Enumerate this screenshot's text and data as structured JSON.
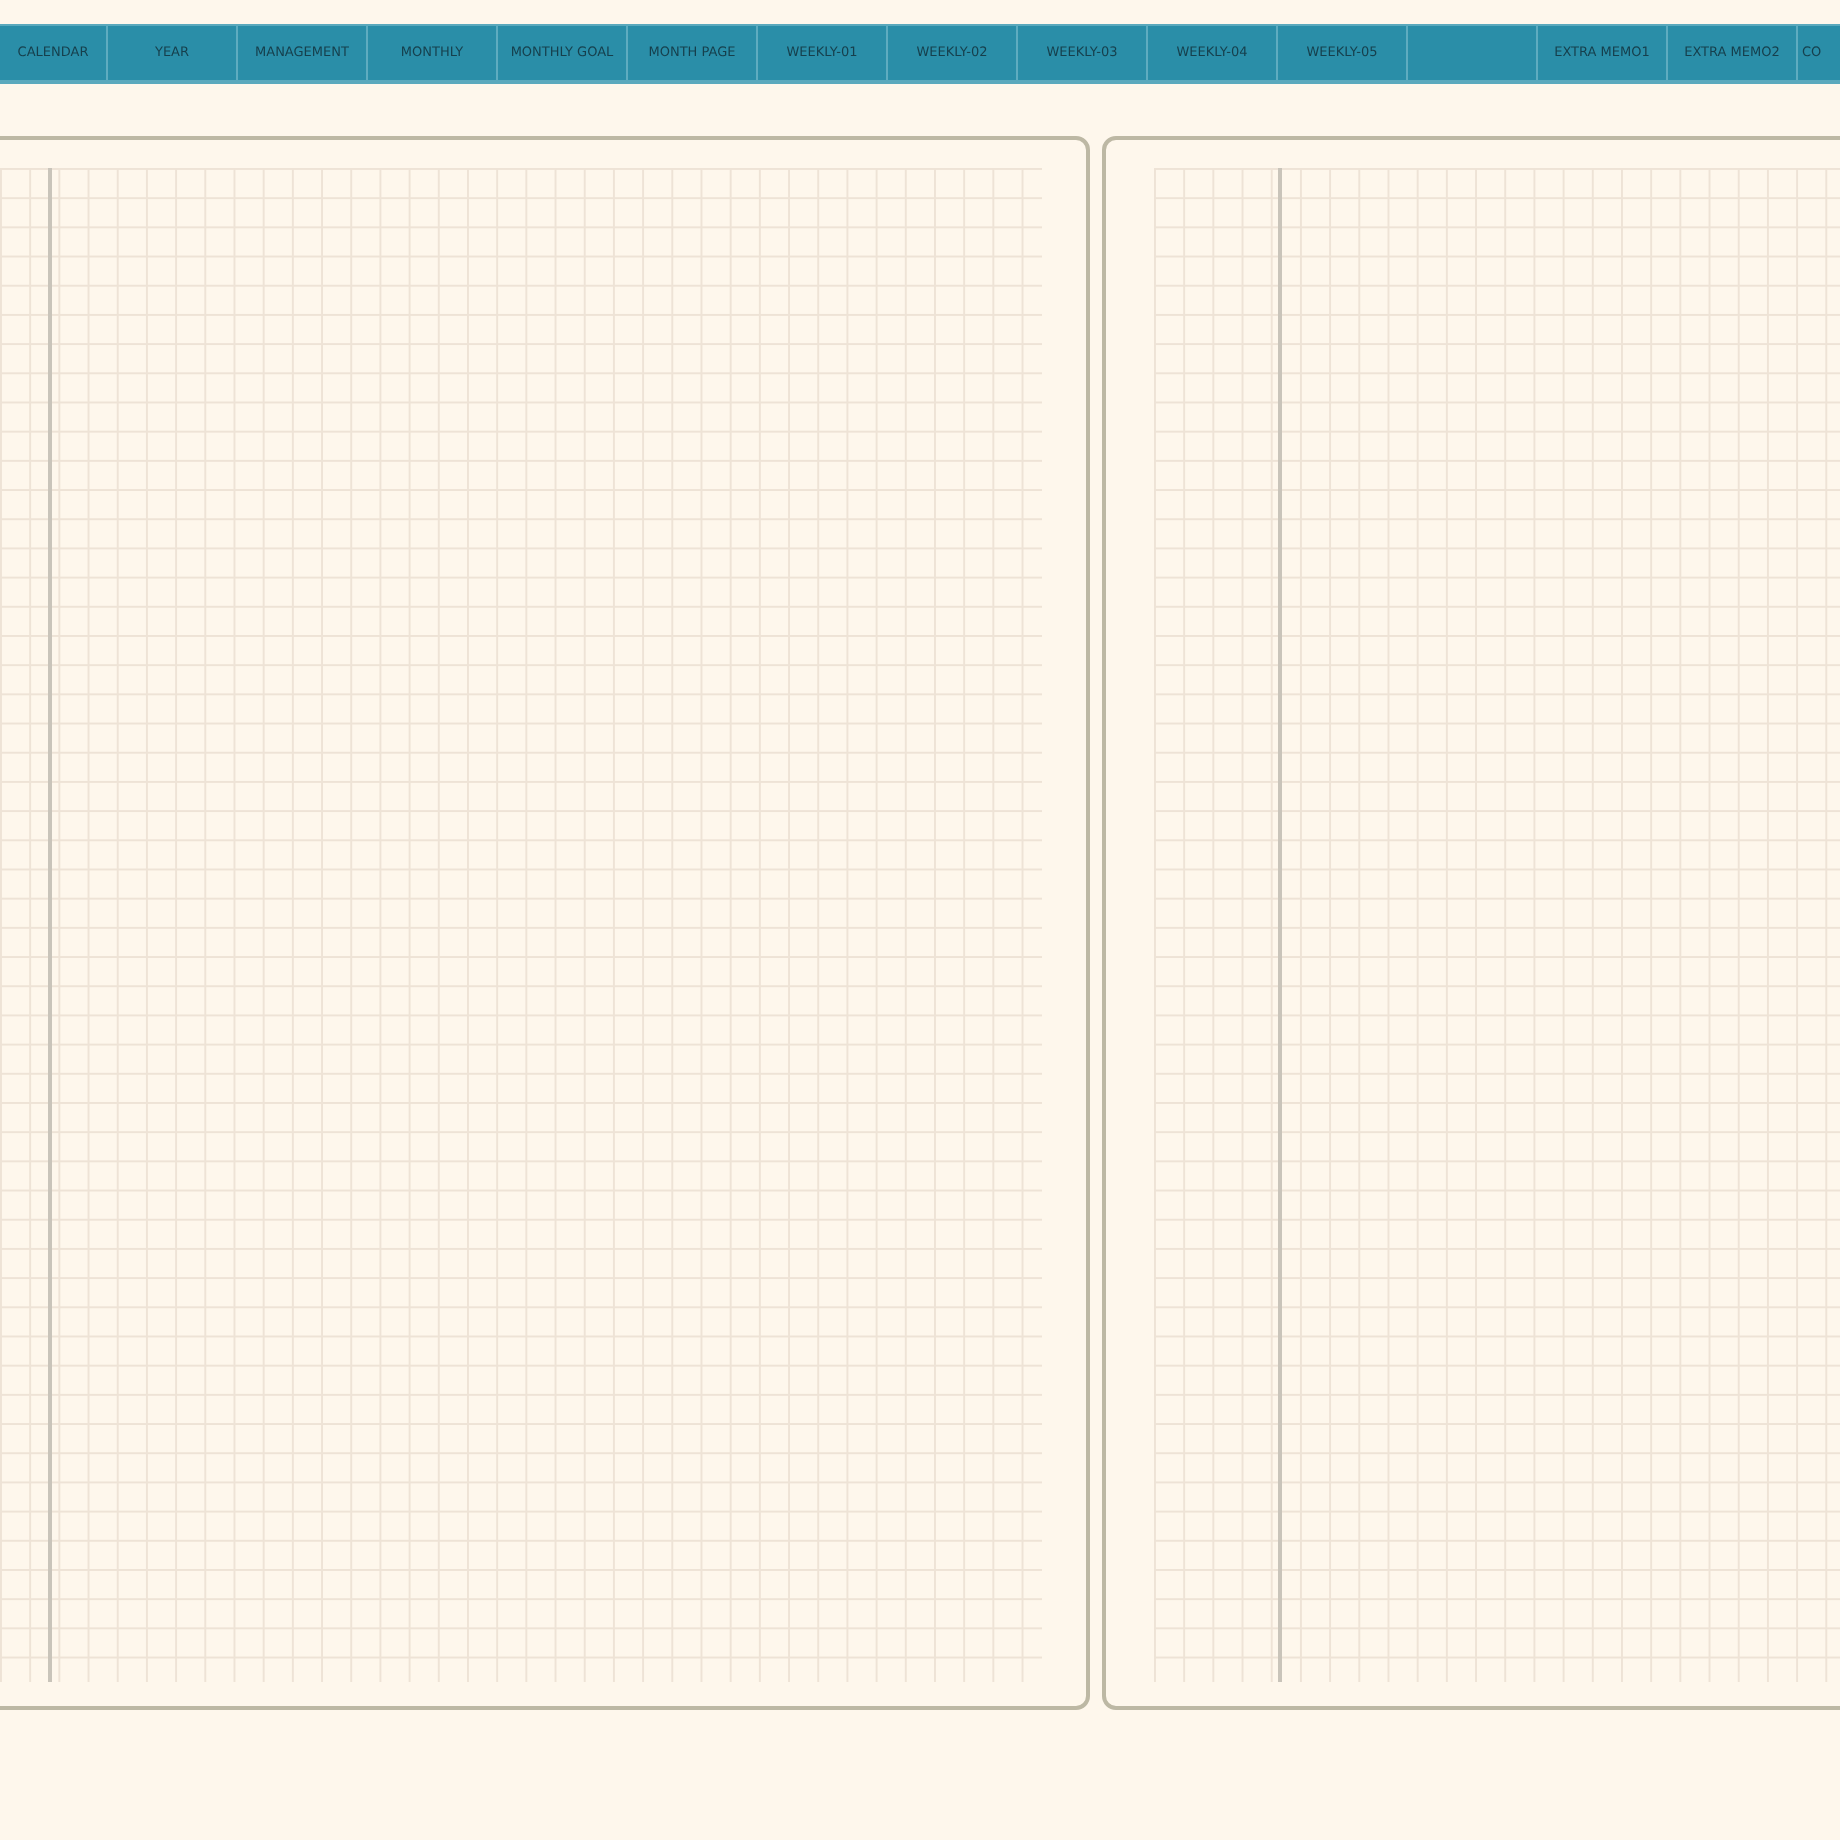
{
  "tabs": [
    {
      "kind": "label",
      "label": "CALENDAR"
    },
    {
      "kind": "label",
      "label": "YEAR"
    },
    {
      "kind": "label",
      "label": "MANAGEMENT"
    },
    {
      "kind": "label",
      "label": "MONTHLY"
    },
    {
      "kind": "label",
      "label": "MONTHLY GOAL"
    },
    {
      "kind": "label",
      "label": "MONTH PAGE"
    },
    {
      "kind": "label",
      "label": "WEEKLY-01"
    },
    {
      "kind": "label",
      "label": "WEEKLY-02"
    },
    {
      "kind": "label",
      "label": "WEEKLY-03"
    },
    {
      "kind": "label",
      "label": "WEEKLY-04"
    },
    {
      "kind": "label",
      "label": "WEEKLY-05"
    },
    {
      "kind": "blank"
    },
    {
      "kind": "label",
      "label": "EXTRA MEMO1"
    },
    {
      "kind": "label",
      "label": "EXTRA MEMO2"
    },
    {
      "kind": "label",
      "label": "CO"
    }
  ],
  "pages": [
    {
      "kind": "grid"
    },
    {
      "kind": "grid"
    }
  ]
}
